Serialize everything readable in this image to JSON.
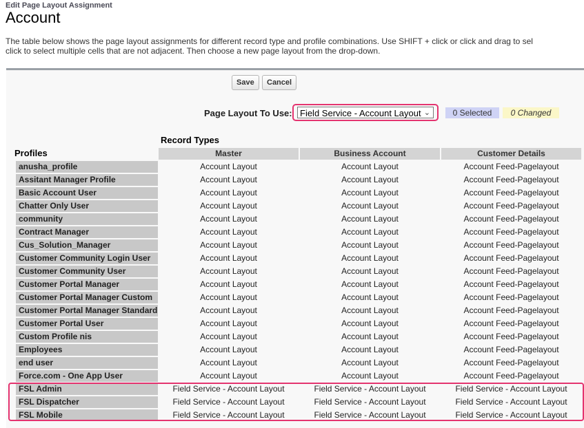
{
  "header": {
    "breadcrumb": "Edit Page Layout Assignment",
    "title": "Account",
    "description": "The table below shows the page layout assignments for different record type and profile combinations. Use SHIFT + click or click and drag to sel",
    "description_line2": "click to select multiple cells that are not adjacent. Then choose a new page layout from the drop-down."
  },
  "toolbar": {
    "save_label": "Save",
    "cancel_label": "Cancel"
  },
  "layout_picker": {
    "label": "Page Layout To Use:",
    "selected_value": "Field Service - Account Layout",
    "selected_count": "0 Selected",
    "changed_count": "0 Changed"
  },
  "colors": {
    "highlight": "#e4336f",
    "selected_badge": "#cfd3f5",
    "changed_badge": "#fbf7c8"
  },
  "table": {
    "record_types_label": "Record Types",
    "profiles_label": "Profiles",
    "columns": [
      "Master",
      "Business Account",
      "Customer Details"
    ],
    "rows": [
      {
        "profile": "anusha_profile",
        "cells": [
          "Account Layout",
          "Account Layout",
          "Account Feed-Pagelayout"
        ]
      },
      {
        "profile": "Assitant Manager Profile",
        "cells": [
          "Account Layout",
          "Account Layout",
          "Account Feed-Pagelayout"
        ]
      },
      {
        "profile": "Basic Account User",
        "cells": [
          "Account Layout",
          "Account Layout",
          "Account Feed-Pagelayout"
        ]
      },
      {
        "profile": "Chatter Only User",
        "cells": [
          "Account Layout",
          "Account Layout",
          "Account Feed-Pagelayout"
        ]
      },
      {
        "profile": "community",
        "cells": [
          "Account Layout",
          "Account Layout",
          "Account Feed-Pagelayout"
        ]
      },
      {
        "profile": "Contract Manager",
        "cells": [
          "Account Layout",
          "Account Layout",
          "Account Feed-Pagelayout"
        ]
      },
      {
        "profile": "Cus_Solution_Manager",
        "cells": [
          "Account Layout",
          "Account Layout",
          "Account Feed-Pagelayout"
        ]
      },
      {
        "profile": "Customer Community Login User",
        "cells": [
          "Account Layout",
          "Account Layout",
          "Account Feed-Pagelayout"
        ]
      },
      {
        "profile": "Customer Community User",
        "cells": [
          "Account Layout",
          "Account Layout",
          "Account Feed-Pagelayout"
        ]
      },
      {
        "profile": "Customer Portal Manager",
        "cells": [
          "Account Layout",
          "Account Layout",
          "Account Feed-Pagelayout"
        ]
      },
      {
        "profile": "Customer Portal Manager Custom",
        "cells": [
          "Account Layout",
          "Account Layout",
          "Account Feed-Pagelayout"
        ]
      },
      {
        "profile": "Customer Portal Manager Standard",
        "cells": [
          "Account Layout",
          "Account Layout",
          "Account Feed-Pagelayout"
        ]
      },
      {
        "profile": "Customer Portal User",
        "cells": [
          "Account Layout",
          "Account Layout",
          "Account Feed-Pagelayout"
        ]
      },
      {
        "profile": "Custom Profile nis",
        "cells": [
          "Account Layout",
          "Account Layout",
          "Account Feed-Pagelayout"
        ]
      },
      {
        "profile": "Employees",
        "cells": [
          "Account Layout",
          "Account Layout",
          "Account Feed-Pagelayout"
        ]
      },
      {
        "profile": "end user",
        "cells": [
          "Account Layout",
          "Account Layout",
          "Account Feed-Pagelayout"
        ]
      },
      {
        "profile": "Force.com - One App User",
        "cells": [
          "Account Layout",
          "Account Layout",
          "Account Feed-Pagelayout"
        ]
      },
      {
        "profile": "FSL Admin",
        "cells": [
          "Field Service - Account Layout",
          "Field Service - Account Layout",
          "Field Service - Account Layout"
        ]
      },
      {
        "profile": "FSL Dispatcher",
        "cells": [
          "Field Service - Account Layout",
          "Field Service - Account Layout",
          "Field Service - Account Layout"
        ]
      },
      {
        "profile": "FSL Mobile",
        "cells": [
          "Field Service - Account Layout",
          "Field Service - Account Layout",
          "Field Service - Account Layout"
        ]
      }
    ]
  }
}
